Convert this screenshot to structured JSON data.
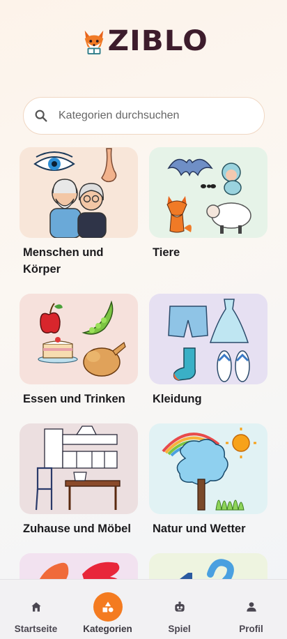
{
  "app": {
    "logo_text": "ZIBLO"
  },
  "search": {
    "placeholder": "Kategorien durchsuchen",
    "value": ""
  },
  "categories": [
    {
      "label": "Menschen und Körper",
      "bg": "#f8e6d9"
    },
    {
      "label": "Tiere",
      "bg": "#e6f3e8"
    },
    {
      "label": "Essen und Trinken",
      "bg": "#f6e1dc"
    },
    {
      "label": "Kleidung",
      "bg": "#e6e0f2"
    },
    {
      "label": "Zuhause und Möbel",
      "bg": "#ecdfe0"
    },
    {
      "label": "Natur und Wetter",
      "bg": "#e1f2f4"
    },
    {
      "label": "",
      "bg": "#f2e2f0"
    },
    {
      "label": "",
      "bg": "#eef4e0"
    }
  ],
  "nav": {
    "items": [
      {
        "label": "Startseite",
        "icon": "home-icon"
      },
      {
        "label": "Kategorien",
        "icon": "categories-icon",
        "active": true
      },
      {
        "label": "Spiel",
        "icon": "game-icon"
      },
      {
        "label": "Profil",
        "icon": "profile-icon"
      }
    ]
  },
  "colors": {
    "accent": "#f47b20",
    "logo": "#3d1c2c",
    "text": "#1b1a1d"
  }
}
